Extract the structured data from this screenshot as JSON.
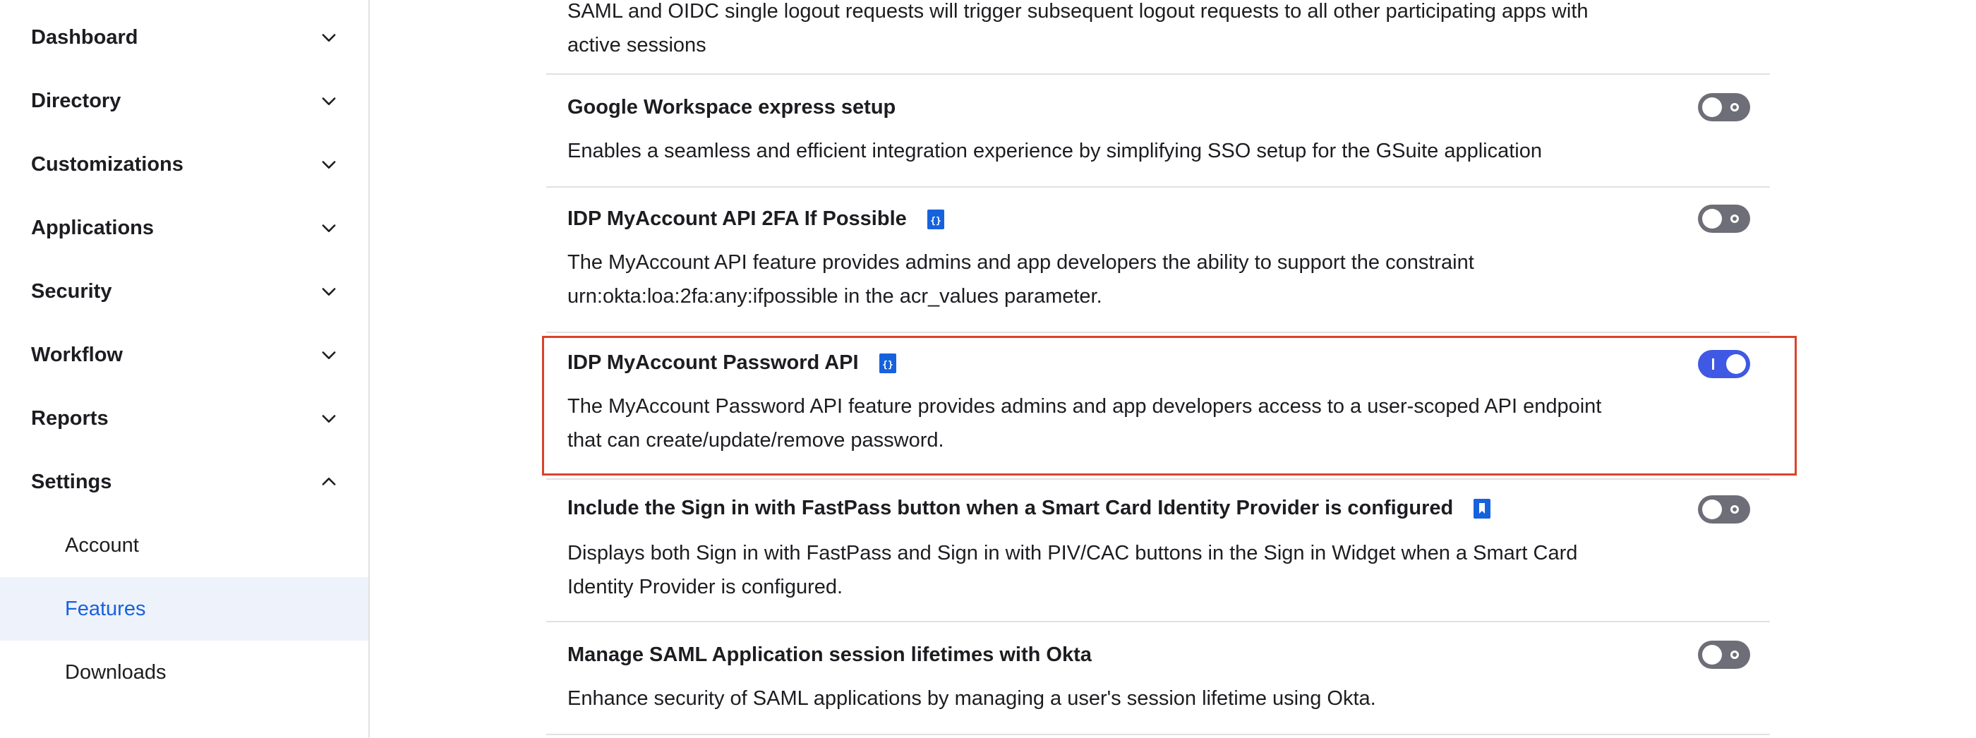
{
  "sidebar": {
    "items": [
      {
        "label": "Dashboard",
        "expanded": false
      },
      {
        "label": "Directory",
        "expanded": false
      },
      {
        "label": "Customizations",
        "expanded": false
      },
      {
        "label": "Applications",
        "expanded": false
      },
      {
        "label": "Security",
        "expanded": false
      },
      {
        "label": "Workflow",
        "expanded": false
      },
      {
        "label": "Reports",
        "expanded": false
      },
      {
        "label": "Settings",
        "expanded": true
      }
    ],
    "settings_children": [
      {
        "label": "Account",
        "active": false
      },
      {
        "label": "Features",
        "active": true
      },
      {
        "label": "Downloads",
        "active": false
      }
    ]
  },
  "features": [
    {
      "title": "",
      "description": "SAML and OIDC single logout requests will trigger subsequent logout requests to all other participating apps with active sessions"
    },
    {
      "title": "Google Workspace express setup",
      "description": "Enables a seamless and efficient integration experience by simplifying SSO setup for the GSuite application",
      "enabled": false,
      "badge": null
    },
    {
      "title": "IDP MyAccount API 2FA If Possible",
      "description": "The MyAccount API feature provides admins and app developers the ability to support the constraint urn:okta:loa:2fa:any:ifpossible in the acr_values parameter.",
      "enabled": false,
      "badge": "api-badge-icon"
    },
    {
      "title": "IDP MyAccount Password API",
      "description": "The MyAccount Password API feature provides admins and app developers access to a user-scoped API endpoint that can create/update/remove password.",
      "enabled": true,
      "badge": "api-badge-icon",
      "highlighted": true
    },
    {
      "title": "Include the Sign in with FastPass button when a Smart Card Identity Provider is configured",
      "description": "Displays both Sign in with FastPass and Sign in with PIV/CAC buttons in the Sign in Widget when a Smart Card Identity Provider is configured.",
      "enabled": false,
      "badge": "bookmark-badge-icon"
    },
    {
      "title": "Manage SAML Application session lifetimes with Okta",
      "description": "Enhance security of SAML applications by managing a user's session lifetime using Okta.",
      "enabled": false,
      "badge": null
    }
  ],
  "colors": {
    "accent": "#1662dd",
    "toggle_on": "#3f59e4",
    "toggle_off": "#6e6e78",
    "highlight_border": "#d9442b",
    "active_nav_bg": "#eef2fb"
  }
}
